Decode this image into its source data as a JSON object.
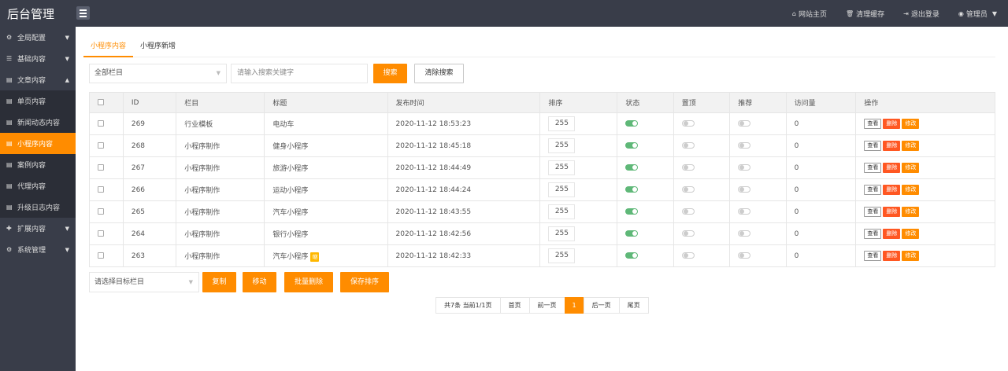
{
  "app": {
    "title": "后台管理"
  },
  "top_links": [
    {
      "icon": "home-icon",
      "glyph": "⌂",
      "label": "网站主页"
    },
    {
      "icon": "trash-icon",
      "glyph": "🗑",
      "label": "清理缓存"
    },
    {
      "icon": "logout-icon",
      "glyph": "⇥",
      "label": "退出登录"
    },
    {
      "icon": "user-icon",
      "glyph": "◉",
      "label": "管理员"
    }
  ],
  "sidebar": {
    "groups": [
      {
        "label": "全局配置",
        "icon": "gear-icon",
        "glyph": "⚙",
        "expanded": false
      },
      {
        "label": "基础内容",
        "icon": "sliders-icon",
        "glyph": "☰",
        "expanded": false
      },
      {
        "label": "文章内容",
        "icon": "file-icon",
        "glyph": "▤",
        "expanded": true,
        "items": [
          {
            "label": "单页内容",
            "active": false
          },
          {
            "label": "新闻动态内容",
            "active": false
          },
          {
            "label": "小程序内容",
            "active": true
          },
          {
            "label": "案例内容",
            "active": false
          },
          {
            "label": "代理内容",
            "active": false
          },
          {
            "label": "升级日志内容",
            "active": false
          }
        ]
      },
      {
        "label": "扩展内容",
        "icon": "puzzle-icon",
        "glyph": "✚",
        "expanded": false
      },
      {
        "label": "系统管理",
        "icon": "settings-icon",
        "glyph": "⚙",
        "expanded": false
      }
    ]
  },
  "tabs": [
    {
      "label": "小程序内容",
      "active": true
    },
    {
      "label": "小程序新增",
      "active": false
    }
  ],
  "search": {
    "category_select": "全部栏目",
    "keyword_placeholder": "请输入搜索关键字",
    "search_button": "搜索",
    "clear_button": "清除搜索"
  },
  "table": {
    "columns": [
      "ID",
      "栏目",
      "标题",
      "发布时间",
      "排序",
      "状态",
      "置顶",
      "推荐",
      "访问量",
      "操作"
    ],
    "rows": [
      {
        "id": "269",
        "category": "行业模板",
        "title": "电动车",
        "time": "2020-11-12 18:53:23",
        "sort": "255",
        "status": true,
        "top": false,
        "recommend": false,
        "visits": "0",
        "tag": ""
      },
      {
        "id": "268",
        "category": "小程序制作",
        "title": "健身小程序",
        "time": "2020-11-12 18:45:18",
        "sort": "255",
        "status": true,
        "top": false,
        "recommend": false,
        "visits": "0",
        "tag": ""
      },
      {
        "id": "267",
        "category": "小程序制作",
        "title": "旅游小程序",
        "time": "2020-11-12 18:44:49",
        "sort": "255",
        "status": true,
        "top": false,
        "recommend": false,
        "visits": "0",
        "tag": ""
      },
      {
        "id": "266",
        "category": "小程序制作",
        "title": "运动小程序",
        "time": "2020-11-12 18:44:24",
        "sort": "255",
        "status": true,
        "top": false,
        "recommend": false,
        "visits": "0",
        "tag": ""
      },
      {
        "id": "265",
        "category": "小程序制作",
        "title": "汽车小程序",
        "time": "2020-11-12 18:43:55",
        "sort": "255",
        "status": true,
        "top": false,
        "recommend": false,
        "visits": "0",
        "tag": ""
      },
      {
        "id": "264",
        "category": "小程序制作",
        "title": "银行小程序",
        "time": "2020-11-12 18:42:56",
        "sort": "255",
        "status": true,
        "top": false,
        "recommend": false,
        "visits": "0",
        "tag": ""
      },
      {
        "id": "263",
        "category": "小程序制作",
        "title": "汽车小程序",
        "time": "2020-11-12 18:42:33",
        "sort": "255",
        "status": true,
        "top": false,
        "recommend": false,
        "visits": "0",
        "tag": "缩"
      }
    ],
    "actions": {
      "view": "查看",
      "delete": "删除",
      "edit": "修改"
    }
  },
  "bulk": {
    "target_select": "请选择目标栏目",
    "copy": "复制",
    "move": "移动",
    "batch_delete": "批量删除",
    "save_sort": "保存排序"
  },
  "pager": {
    "info": "共7条 当前1/1页",
    "first": "首页",
    "prev": "前一页",
    "current": "1",
    "next": "后一页",
    "last": "尾页"
  },
  "colors": {
    "accent": "#FF8C00",
    "topbar": "#393D49",
    "sub_menu": "#2B2E37",
    "switch_on": "#5FB878",
    "danger": "#FF5722"
  }
}
